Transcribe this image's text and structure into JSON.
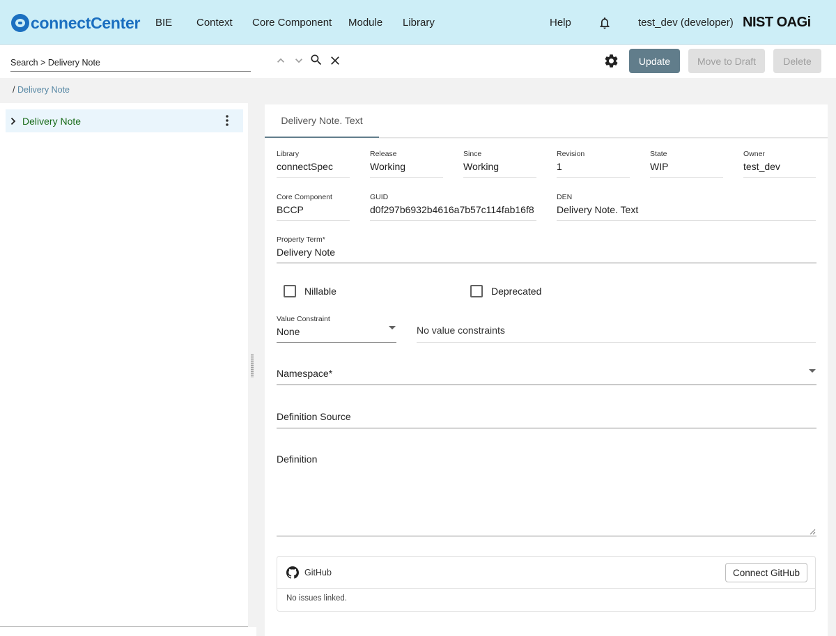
{
  "header": {
    "logo_text": "connectCenter",
    "nav": [
      "BIE",
      "Context",
      "Core Component",
      "Module",
      "Library"
    ],
    "help_label": "Help",
    "user_label": "test_dev (developer)",
    "org_logo_text": "NIST OAGi"
  },
  "search": {
    "value": "Search > Delivery Note"
  },
  "toolbar": {
    "update_label": "Update",
    "move_to_draft_label": "Move to Draft",
    "delete_label": "Delete"
  },
  "breadcrumb": {
    "separator": "/",
    "current": "Delivery Note"
  },
  "tree": {
    "root_label": "Delivery Note"
  },
  "detail": {
    "tab_label": "Delivery Note. Text",
    "fields": {
      "library": {
        "label": "Library",
        "value": "connectSpec"
      },
      "release": {
        "label": "Release",
        "value": "Working"
      },
      "since": {
        "label": "Since",
        "value": "Working"
      },
      "revision": {
        "label": "Revision",
        "value": "1"
      },
      "state": {
        "label": "State",
        "value": "WIP"
      },
      "owner": {
        "label": "Owner",
        "value": "test_dev"
      },
      "core_component": {
        "label": "Core Component",
        "value": "BCCP"
      },
      "guid": {
        "label": "GUID",
        "value": "d0f297b6932b4616a7b57c114fab16f8"
      },
      "den": {
        "label": "DEN",
        "value": "Delivery Note. Text"
      },
      "property_term": {
        "label": "Property Term*",
        "value": "Delivery Note"
      }
    },
    "nillable_label": "Nillable",
    "deprecated_label": "Deprecated",
    "nillable_checked": false,
    "deprecated_checked": false,
    "value_constraint": {
      "label": "Value Constraint",
      "value": "None"
    },
    "value_constraint_text": "No value constraints",
    "namespace_placeholder": "Namespace*",
    "definition_source_placeholder": "Definition Source",
    "definition_placeholder": "Definition"
  },
  "github": {
    "title": "GitHub",
    "connect_label": "Connect GitHub",
    "empty_text": "No issues linked."
  },
  "colors": {
    "header_bg": "#cdeef7",
    "brand": "#1b6fc0",
    "primary_button": "#617d8b",
    "tree_label": "#1a6b1a",
    "breadcrumb_link": "#5a8aa6"
  }
}
